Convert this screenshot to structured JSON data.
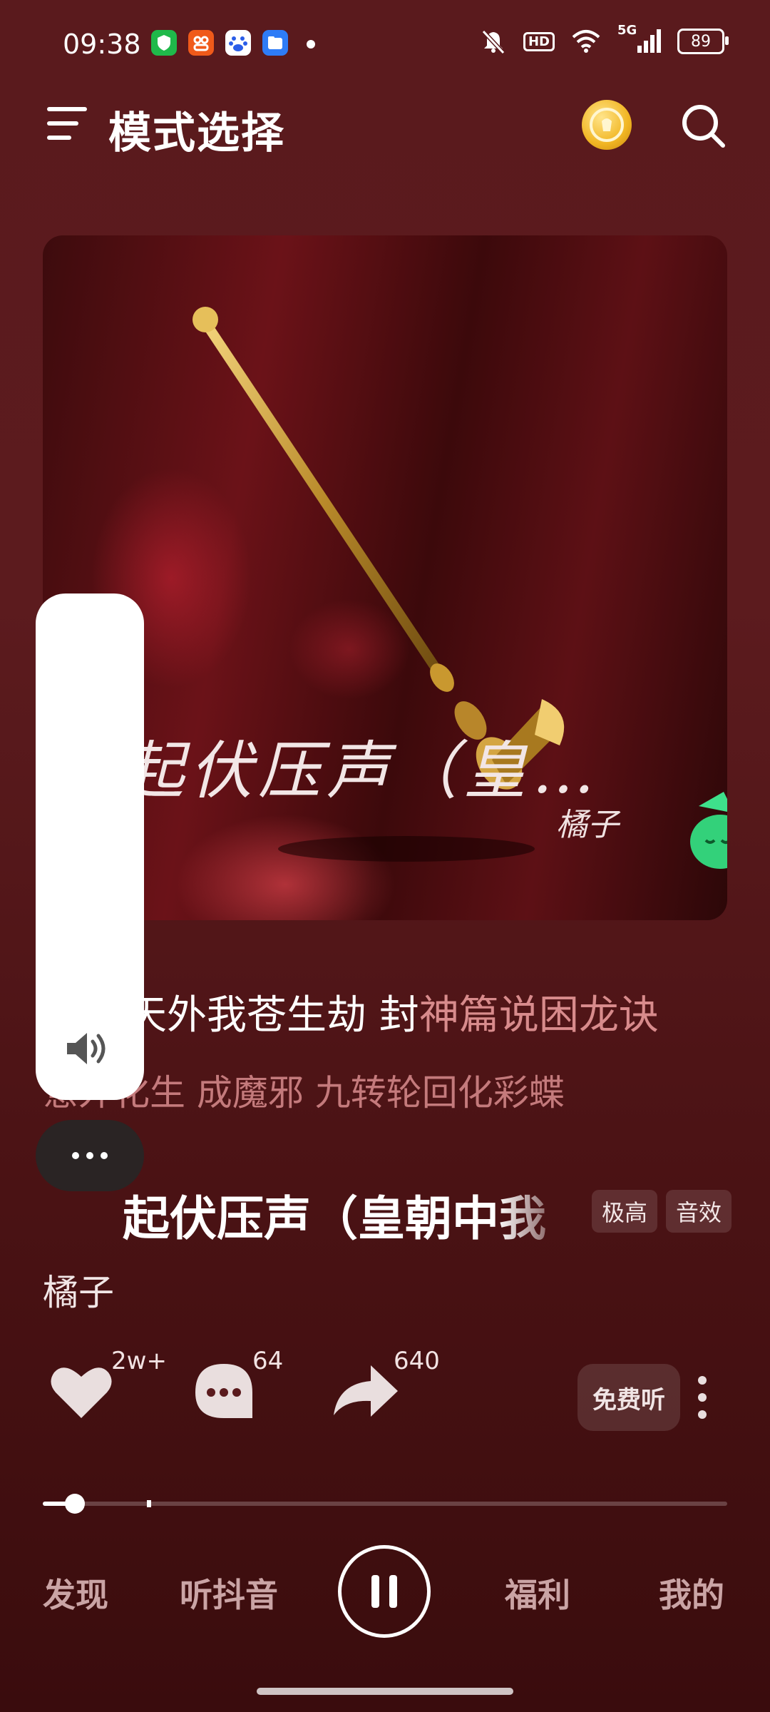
{
  "status_bar": {
    "time": "09:38",
    "app_icons": [
      {
        "name": "shield-app-icon",
        "color": "#1fb94a"
      },
      {
        "name": "social-app-icon",
        "color": "#f05a1a"
      },
      {
        "name": "baidu-app-icon",
        "color": "#ffffff"
      },
      {
        "name": "files-app-icon",
        "color": "#2e7cf6"
      }
    ],
    "hd_label": "HD",
    "network_label": "5G",
    "battery": "89"
  },
  "header": {
    "title": "模式选择"
  },
  "album": {
    "art_text": "起伏压声（皇…",
    "art_artist": "橘子"
  },
  "lyrics": {
    "line1_sung": "天外我苍生劫 封",
    "line1_unsung": "神篇说困龙诀",
    "line2": "意外化生 成魔邪 九转轮回化彩蝶"
  },
  "song": {
    "title": "起伏压声（皇朝中我",
    "quality_tag": "极高",
    "effect_tag": "音效",
    "artist": "橘子"
  },
  "actions": {
    "likes": "2w+",
    "comments": "64",
    "shares": "640",
    "free_listen": "免费听"
  },
  "progress": {
    "played_fraction": 0.047,
    "buffered_fraction": 0.155
  },
  "nav": {
    "discover": "发现",
    "listen_douyin": "听抖音",
    "welfare": "福利",
    "mine": "我的"
  },
  "colors": {
    "background": "#5a1a1d",
    "lyric_unsung": "#d88b8c",
    "nav_text": "#caa4a5"
  }
}
